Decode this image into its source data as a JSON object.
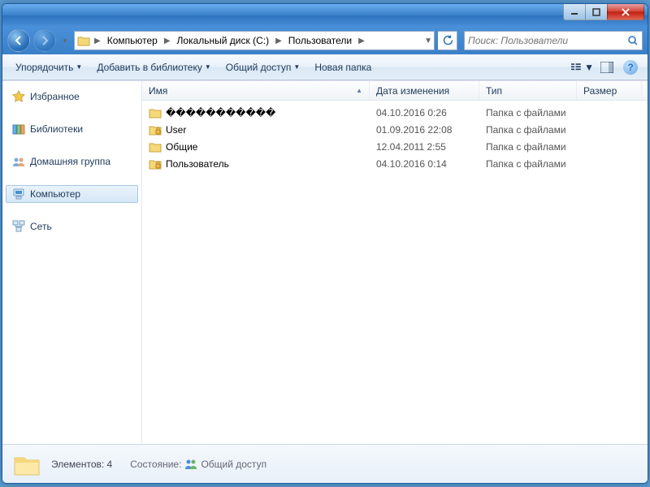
{
  "breadcrumbs": [
    "Компьютер",
    "Локальный диск (C:)",
    "Пользователи"
  ],
  "search": {
    "placeholder": "Поиск: Пользователи"
  },
  "toolbar": {
    "organize": "Упорядочить",
    "addlib": "Добавить в библиотеку",
    "share": "Общий доступ",
    "newfolder": "Новая папка"
  },
  "sidebar": {
    "favorites": "Избранное",
    "libraries": "Библиотеки",
    "homegroup": "Домашняя группа",
    "computer": "Компьютер",
    "network": "Сеть"
  },
  "columns": {
    "name": "Имя",
    "date": "Дата изменения",
    "type": "Тип",
    "size": "Размер"
  },
  "items": [
    {
      "name": "�����������",
      "date": "04.10.2016 0:26",
      "type": "Папка с файлами",
      "locked": false
    },
    {
      "name": "User",
      "date": "01.09.2016 22:08",
      "type": "Папка с файлами",
      "locked": true
    },
    {
      "name": "Общие",
      "date": "12.04.2011 2:55",
      "type": "Папка с файлами",
      "locked": false
    },
    {
      "name": "Пользователь",
      "date": "04.10.2016 0:14",
      "type": "Папка с файлами",
      "locked": true
    }
  ],
  "status": {
    "count_label": "Элементов: 4",
    "state_label": "Состояние:",
    "state_value": "Общий доступ"
  }
}
